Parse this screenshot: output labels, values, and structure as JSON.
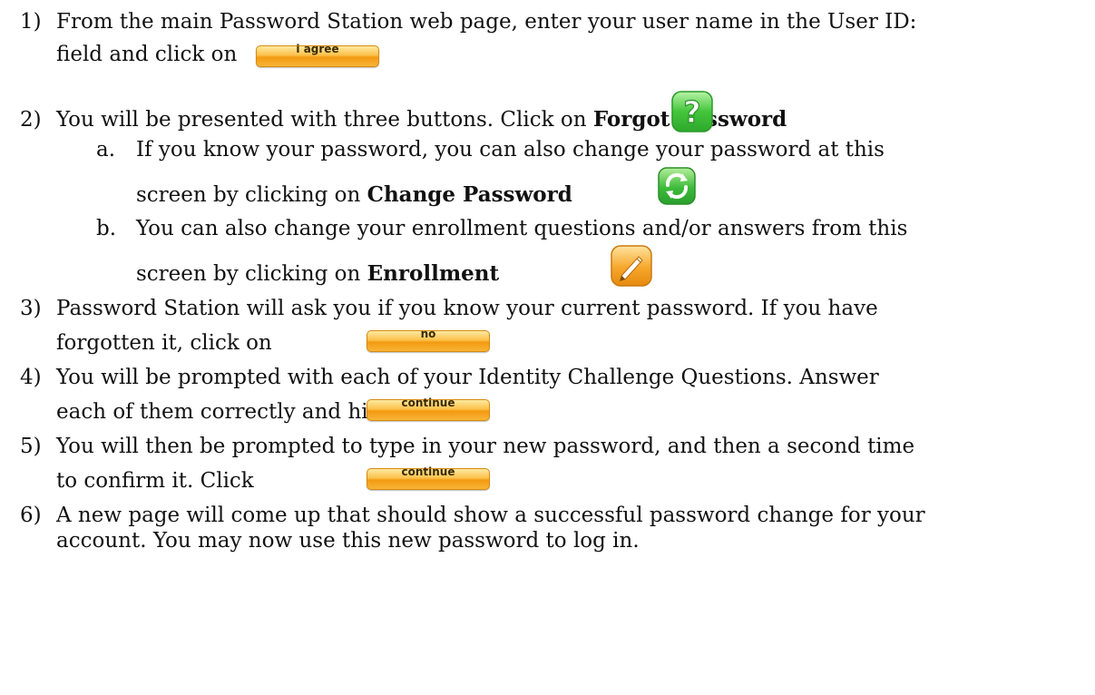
{
  "steps": [
    {
      "number": "1)",
      "line1": "From the main Password Station web page, enter your user name in the User ID:",
      "line2": "field and click on",
      "button": "i agree"
    },
    {
      "number": "2)",
      "text": "You will be presented with three buttons. Click on ",
      "bold": "Forgot Password",
      "icon": "question-icon",
      "sub": [
        {
          "letter": "a.",
          "line1": "If you know your password, you can also change your password at this",
          "line2": "screen by clicking on ",
          "bold": "Change Password",
          "icon": "refresh-icon"
        },
        {
          "letter": "b.",
          "line1": "You can also change your enrollment questions and/or answers from this",
          "line2": "screen by clicking on ",
          "bold": "Enrollment",
          "icon": "pen-icon"
        }
      ]
    },
    {
      "number": "3)",
      "line1": "Password Station will ask you if you know your current password. If you have",
      "line2": "forgotten it, click on",
      "button": "no"
    },
    {
      "number": "4)",
      "line1": "You will be prompted with each of your Identity Challenge Questions. Answer",
      "line2": "each of them correctly and hit",
      "button": "continue"
    },
    {
      "number": "5)",
      "line1": "You will then be prompted to type in your new password, and then a second time",
      "line2": "to confirm it.  Click",
      "button": "continue"
    },
    {
      "number": "6)",
      "line1": "A new page will come up that should show a successful password change for your",
      "line2": "account. You may now use this new password to log in."
    }
  ],
  "colors": {
    "button_orange": "#f7a51f",
    "question_green": "#3cc43a",
    "refresh_green": "#2fae3a",
    "pen_orange": "#f39a12"
  }
}
